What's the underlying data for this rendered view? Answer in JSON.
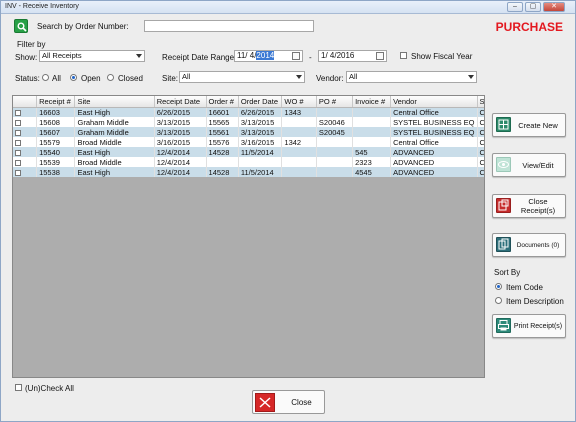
{
  "window": {
    "title": "INV - Receive Inventory",
    "minimize": "–",
    "maximize": "▢",
    "close": "✕"
  },
  "header": {
    "search_label": "Search by Order Number:",
    "search_value": "",
    "mode": "PURCHASE"
  },
  "filters": {
    "group_label": "Filter by",
    "show_label": "Show:",
    "show_value": "All Receipts",
    "date_range_label": "Receipt Date Range:",
    "date_from_prefix": "11/ 4/",
    "date_from_year": "2014",
    "date_sep": "-",
    "date_to": "1/ 4/2016",
    "fiscal_label": "Show Fiscal Year",
    "status_label": "Status:",
    "status_all": "All",
    "status_open": "Open",
    "status_closed": "Closed",
    "site_label": "Site:",
    "site_value": "All",
    "vendor_label": "Vendor:",
    "vendor_value": "All"
  },
  "table": {
    "columns": [
      "",
      "Receipt #",
      "Site",
      "Receipt Date",
      "Order #",
      "Order Date",
      "WO #",
      "PO #",
      "Invoice #",
      "Vendor",
      "S"
    ],
    "rows": [
      [
        "16603",
        "East High",
        "6/26/2015",
        "16601",
        "6/26/2015",
        "1343",
        "",
        "",
        "Central Office",
        "C"
      ],
      [
        "15608",
        "Graham Middle",
        "3/13/2015",
        "15565",
        "3/13/2015",
        "",
        "S20046",
        "",
        "SYSTEL BUSINESS EQ",
        "C"
      ],
      [
        "15607",
        "Graham Middle",
        "3/13/2015",
        "15561",
        "3/13/2015",
        "",
        "S20045",
        "",
        "SYSTEL BUSINESS EQ",
        "C"
      ],
      [
        "15579",
        "Broad Middle",
        "3/16/2015",
        "15576",
        "3/16/2015",
        "1342",
        "",
        "",
        "Central Office",
        "C"
      ],
      [
        "15540",
        "East High",
        "12/4/2014",
        "14528",
        "11/5/2014",
        "",
        "",
        "545",
        "ADVANCED",
        "C"
      ],
      [
        "15539",
        "Broad Middle",
        "12/4/2014",
        "",
        "",
        "",
        "",
        "2323",
        "ADVANCED",
        "C"
      ],
      [
        "15538",
        "East High",
        "12/4/2014",
        "14528",
        "11/5/2014",
        "",
        "",
        "4545",
        "ADVANCED",
        "C"
      ]
    ]
  },
  "actions": {
    "create_new": "Create New",
    "view_edit": "View/Edit",
    "close_receipts": "Close Receipt(s)",
    "documents": "Documents (0)",
    "sort_by_label": "Sort By",
    "sort_item_code": "Item Code",
    "sort_item_description": "Item Description",
    "print_receipts": "Print Receipt(s)"
  },
  "footer": {
    "check_all": "(Un)Check All",
    "close": "Close"
  }
}
